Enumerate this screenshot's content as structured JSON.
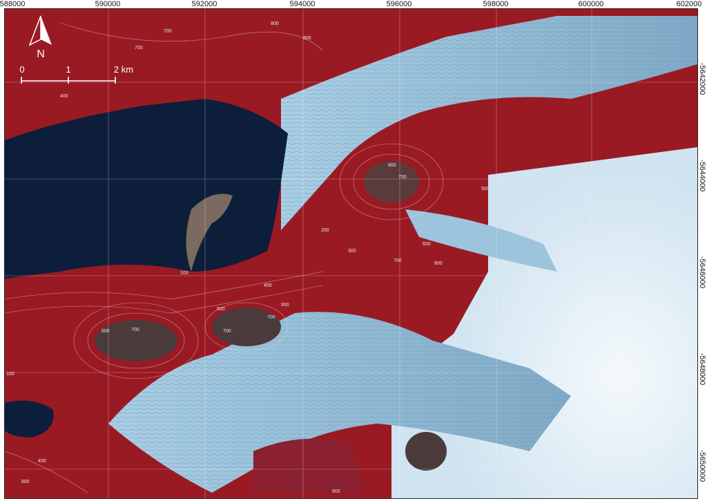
{
  "axes": {
    "x_ticks": [
      "588000",
      "590000",
      "592000",
      "594000",
      "596000",
      "598000",
      "600000",
      "602000"
    ],
    "y_ticks": [
      "-5642000",
      "-5644000",
      "-5646000",
      "-5648000",
      "-5650000"
    ]
  },
  "north_arrow": {
    "label": "N"
  },
  "scale_bar": {
    "labels": [
      "0",
      "1",
      "2 km"
    ]
  },
  "contour_labels": [
    "700",
    "700",
    "800",
    "800",
    "400",
    "800",
    "700",
    "500",
    "200",
    "300",
    "600",
    "700",
    "800",
    "100",
    "400",
    "500",
    "600",
    "700",
    "700",
    "700",
    "900",
    "100",
    "400",
    "800",
    "900"
  ],
  "colors": {
    "vegetation": "#9a1a24",
    "water": "#0d1e3a",
    "glacier": "#8fb9d6",
    "snow": "#eef5fa",
    "rock": "#3a2a2a"
  }
}
